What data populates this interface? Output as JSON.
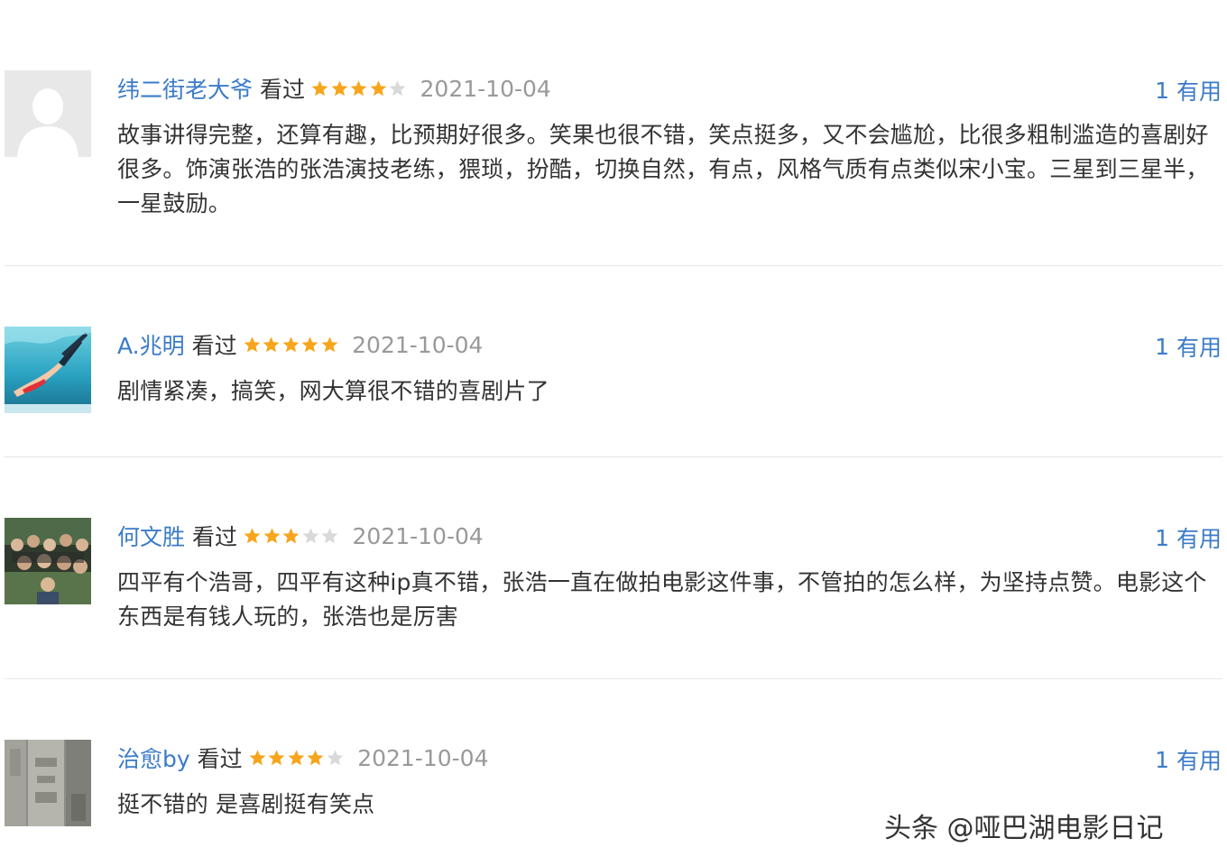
{
  "reviews": [
    {
      "user": "纬二街老大爷",
      "status": "看过",
      "rating": 4,
      "date": "2021-10-04",
      "useful_count": "1",
      "useful_label": "有用",
      "content": "故事讲得完整，还算有趣，比预期好很多。笑果也很不错，笑点挺多，又不会尴尬，比很多粗制滥造的喜剧好很多。饰演张浩的张浩演技老练，猥琐，扮酷，切换自然，有点，风格气质有点类似宋小宝。三星到三星半，一星鼓励。",
      "avatar_icon": "default-user-avatar-icon"
    },
    {
      "user": "A.兆明",
      "status": "看过",
      "rating": 5,
      "date": "2021-10-04",
      "useful_count": "1",
      "useful_label": "有用",
      "content": "剧情紧凑，搞笑，网大算很不错的喜剧片了",
      "avatar_icon": "underwater-diver-avatar"
    },
    {
      "user": "何文胜",
      "status": "看过",
      "rating": 3,
      "date": "2021-10-04",
      "useful_count": "1",
      "useful_label": "有用",
      "content": "四平有个浩哥，四平有这种ip真不错，张浩一直在做拍电影这件事，不管拍的怎么样，为坚持点赞。电影这个东西是有钱人玩的，张浩也是厉害",
      "avatar_icon": "group-photo-avatar"
    },
    {
      "user": "治愈by",
      "status": "看过",
      "rating": 4,
      "date": "2021-10-04",
      "useful_count": "1",
      "useful_label": "有用",
      "content": "挺不错的 是喜剧挺有笑点",
      "avatar_icon": "stone-carving-avatar"
    }
  ],
  "watermark": "头条 @哑巴湖电影日记",
  "colors": {
    "link": "#3b7bc8",
    "star_filled": "#f7a51c",
    "star_empty": "#d9d9d9",
    "date": "#999999",
    "text": "#333333",
    "divider": "#e6e6e6"
  }
}
